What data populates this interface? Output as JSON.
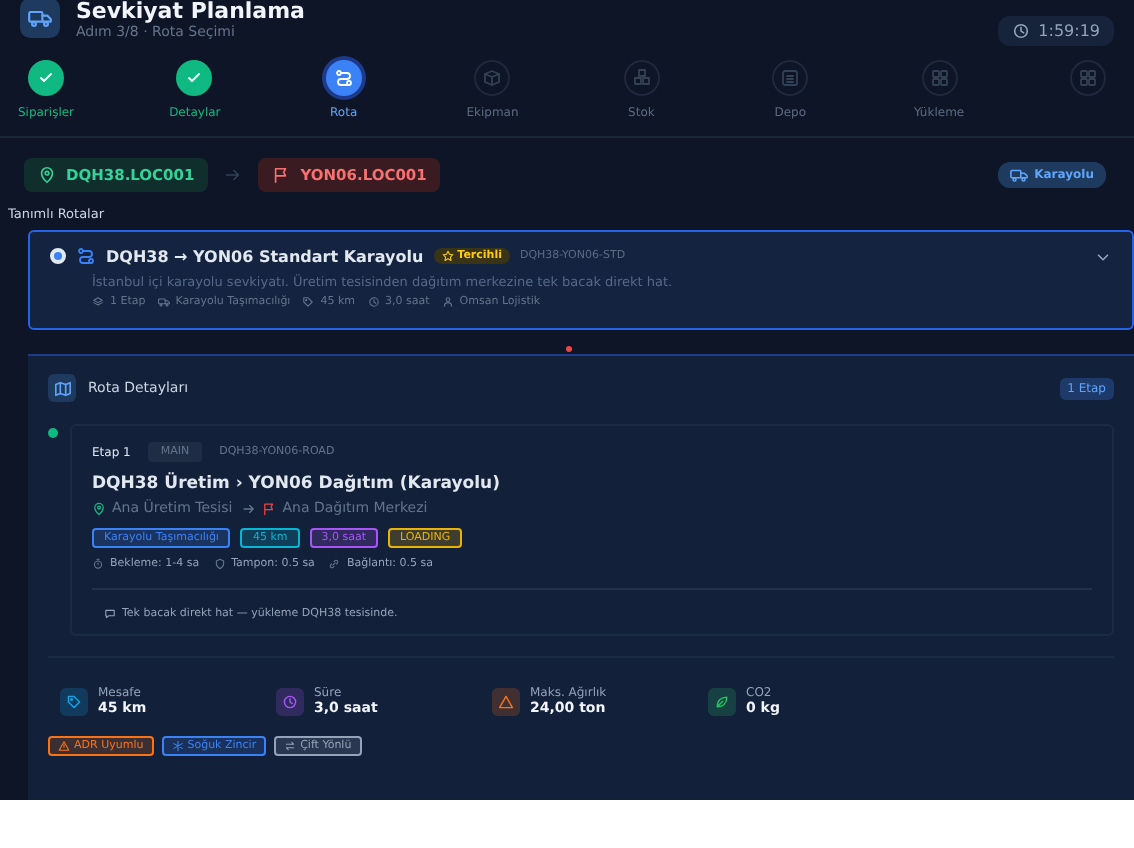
{
  "header": {
    "title": "Sevkiyat Planlama",
    "subtitle": "Adım 3/8 · Rota Seçimi",
    "timer": "1:59:19"
  },
  "steps": [
    {
      "label": "Siparişler",
      "completed": true,
      "selected": false
    },
    {
      "label": "Detaylar",
      "completed": true,
      "selected": false
    },
    {
      "label": "Rota",
      "completed": false,
      "selected": true
    },
    {
      "label": "Ekipman",
      "completed": false,
      "selected": false
    },
    {
      "label": "Stok",
      "completed": false,
      "selected": false
    },
    {
      "label": "Depo",
      "completed": false,
      "selected": false
    },
    {
      "label": "Yükleme",
      "completed": false,
      "selected": false
    },
    {
      "completed": false,
      "selected": false
    }
  ],
  "locations": {
    "origin": "DQH38.LOC001",
    "destination": "YON06.LOC001",
    "mode": "Karayolu"
  },
  "routes_label": "Tanımlı Rotalar",
  "routes": [
    {
      "selected": true,
      "title": "DQH38 → YON06 Standart Karayolu",
      "badge": "Tercihli",
      "code": "DQH38-YON06-STD",
      "description": "İstanbul içi karayolu sevkiyatı. Üretim tesisinden dağıtım merkezine tek bacak direkt hat.",
      "meta": [
        "1 Etap",
        "Karayolu Taşımacılığı",
        "45 km",
        "3,0 saat",
        "Omsan Lojistik"
      ]
    }
  ],
  "details": {
    "title": "Rota Detayları",
    "count": "1 Etap",
    "stages": [
      {
        "number": "Etap 1",
        "type": "MAIN",
        "code": "DQH38-YON06-ROAD",
        "title": "DQH38 Üretim › YON06 Dağıtım (Karayolu)",
        "from": "Ana Üretim Tesisi",
        "to": "Ana Dağıtım Merkezi",
        "tags": [
          {
            "text": "Karayolu Taşımacılığı",
            "color": "#3b82f6"
          },
          {
            "text": "45 km",
            "color": "#06b6d4"
          },
          {
            "text": "3,0 saat",
            "color": "#a855f7"
          },
          {
            "text": "LOADING",
            "color": "#eab308"
          }
        ],
        "timing": [
          "Bekleme: 1-4 sa",
          "Tampon: 0.5 sa",
          "Bağlantı: 0.5 sa"
        ],
        "note": "Tek bacak direkt hat — yükleme DQH38 tesisinde."
      }
    ],
    "stats": [
      {
        "label": "Mesafe",
        "value": "45 km",
        "color": "#0ea5e9"
      },
      {
        "label": "Süre",
        "value": "3,0 saat",
        "color": "#a855f7"
      },
      {
        "label": "Maks. Ağırlık",
        "value": "24,00 ton",
        "color": "#f97316"
      },
      {
        "label": "CO2",
        "value": "0 kg",
        "color": "#22c55e"
      }
    ],
    "flags": [
      {
        "text": "ADR Uyumlu",
        "color": "#f97316"
      },
      {
        "text": "Soğuk Zincir",
        "color": "#3b82f6"
      },
      {
        "text": "Çift Yönlü",
        "color": "#94a3b8"
      }
    ]
  }
}
